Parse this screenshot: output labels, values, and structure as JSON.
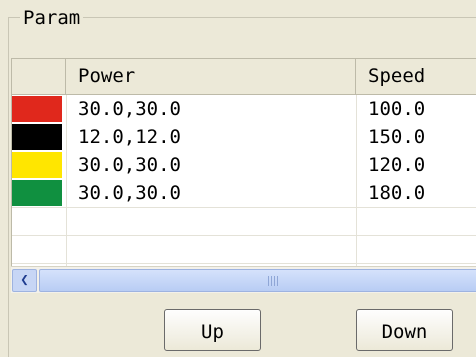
{
  "group": {
    "title": "Param"
  },
  "table": {
    "columns": [
      "",
      "Power",
      "Speed"
    ],
    "rows": [
      {
        "color": "#e0281c",
        "power": "30.0,30.0",
        "speed": "100.0"
      },
      {
        "color": "#000000",
        "power": "12.0,12.0",
        "speed": "150.0"
      },
      {
        "color": "#ffe600",
        "power": "30.0,30.0",
        "speed": "120.0"
      },
      {
        "color": "#109040",
        "power": "30.0,30.0",
        "speed": "180.0"
      }
    ]
  },
  "buttons": {
    "up": "Up",
    "down": "Down"
  },
  "icons": {
    "scroll_left": "chevron-left-icon",
    "scroll_grip": "grip-icon"
  }
}
